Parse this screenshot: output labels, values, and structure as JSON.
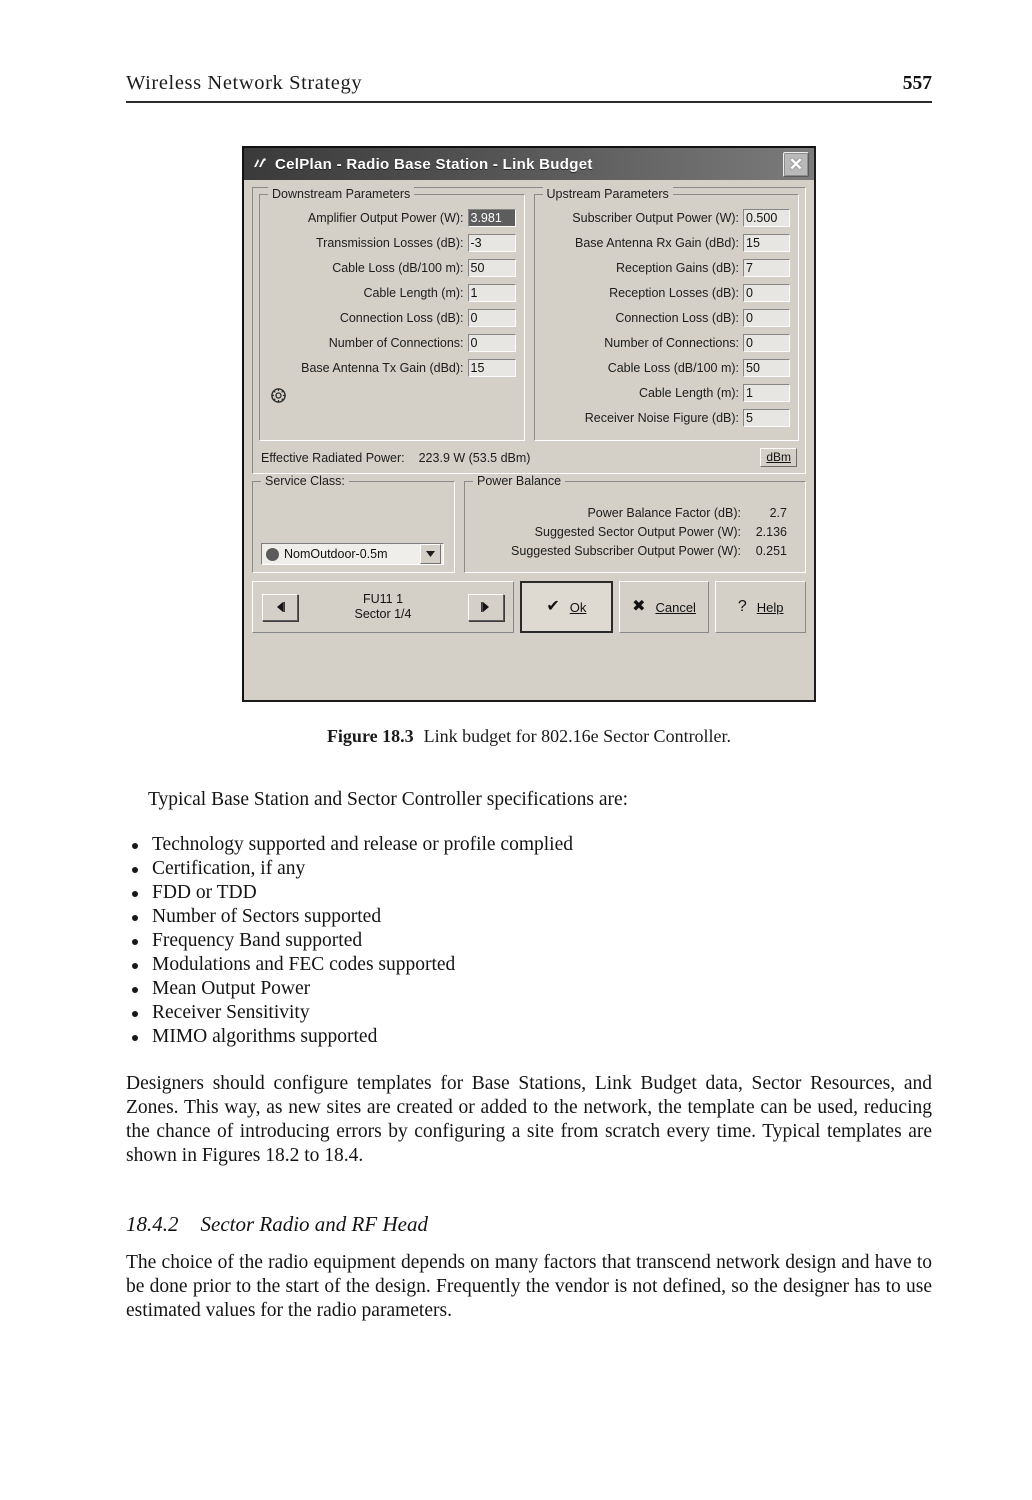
{
  "running_head": {
    "title": "Wireless Network Strategy",
    "page_number": "557"
  },
  "dialog": {
    "title": "CelPlan - Radio Base Station - Link Budget",
    "title_icon": "celplan-logo-icon",
    "close_label": "✕",
    "downstream": {
      "legend": "Downstream Parameters",
      "fields": [
        {
          "label": "Amplifier Output Power (W):",
          "value": "3.981",
          "selected": true
        },
        {
          "label": "Transmission Losses (dB):",
          "value": "-3",
          "selected": false
        },
        {
          "label": "Cable Loss (dB/100 m):",
          "value": "50",
          "selected": false
        },
        {
          "label": "Cable Length (m):",
          "value": "1",
          "selected": false
        },
        {
          "label": "Connection Loss (dB):",
          "value": "0",
          "selected": false
        },
        {
          "label": "Number of Connections:",
          "value": "0",
          "selected": false
        },
        {
          "label": "Base Antenna Tx Gain (dBd):",
          "value": "15",
          "selected": false
        }
      ],
      "gear_icon": "settings-gear-icon"
    },
    "upstream": {
      "legend": "Upstream Parameters",
      "fields": [
        {
          "label": "Subscriber Output Power (W):",
          "value": "0.500"
        },
        {
          "label": "Base Antenna Rx Gain (dBd):",
          "value": "15"
        },
        {
          "label": "Reception Gains (dB):",
          "value": "7"
        },
        {
          "label": "Reception Losses (dB):",
          "value": "0"
        },
        {
          "label": "Connection Loss (dB):",
          "value": "0"
        },
        {
          "label": "Number of Connections:",
          "value": "0"
        },
        {
          "label": "Cable Loss (dB/100 m):",
          "value": "50"
        },
        {
          "label": "Cable Length (m):",
          "value": "1"
        },
        {
          "label": "Receiver Noise Figure (dB):",
          "value": "5"
        }
      ]
    },
    "erp": {
      "label": "Effective Radiated Power:",
      "value": "223.9 W (53.5 dBm)",
      "unit_button": "dBm"
    },
    "service_class": {
      "legend": "Service Class:",
      "selected": "NomOutdoor-0.5m"
    },
    "power_balance": {
      "legend": "Power Balance",
      "rows": [
        {
          "label": "Power Balance Factor (dB):",
          "value": "2.7"
        },
        {
          "label": "Suggested Sector Output Power (W):",
          "value": "2.136"
        },
        {
          "label": "Suggested Subscriber Output Power (W):",
          "value": "0.251"
        }
      ]
    },
    "nav": {
      "prev_glyph": "◀",
      "next_glyph": "▶",
      "line1": "FU11 1",
      "line2": "Sector 1/4"
    },
    "buttons": {
      "ok": "Ok",
      "cancel": "Cancel",
      "help": "Help",
      "ok_glyph": "✔",
      "cancel_glyph": "✖",
      "help_glyph": "?"
    }
  },
  "figure": {
    "number": "Figure 18.3",
    "caption": "Link budget for 802.16e Sector Controller."
  },
  "body": {
    "lead": "Typical Base Station and Sector Controller specifications are:",
    "bullets": [
      "Technology supported and release or profile complied",
      "Certification, if any",
      "FDD or TDD",
      "Number of Sectors supported",
      "Frequency Band supported",
      "Modulations and FEC codes supported",
      "Mean Output Power",
      "Receiver Sensitivity",
      "MIMO algorithms supported"
    ],
    "paragraph1": "Designers should configure templates for Base Stations, Link Budget data, Sector Resources, and Zones. This way, as new sites are created or added to the network, the template can be used, reducing the chance of introducing errors by configuring a site from scratch every time. Typical templates are shown in Figures 18.2 to 18.4.",
    "section": {
      "number": "18.4.2",
      "title": "Sector Radio and RF Head"
    },
    "paragraph2": "The choice of the radio equipment depends on many factors that transcend network design and have to be done prior to the start of the design. Frequently the vendor is not defined, so the designer has to use estimated values for the radio parameters."
  }
}
